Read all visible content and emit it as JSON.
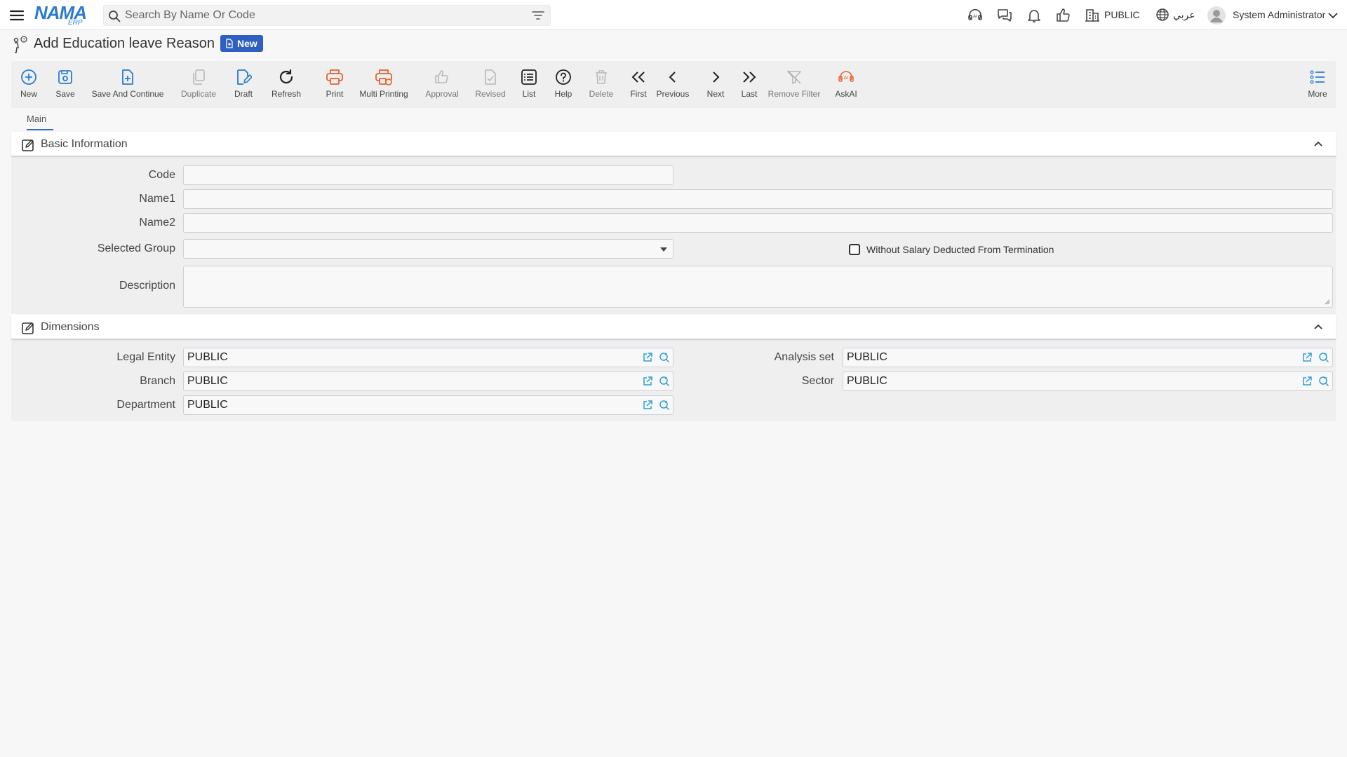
{
  "app": {
    "logo_text": "NAMA",
    "logo_sub": "ERP",
    "search_placeholder": "Search By Name Or Code",
    "company": "PUBLIC",
    "language": "عربي",
    "user": "System Administrator"
  },
  "page": {
    "title": "Add Education leave Reason",
    "badge": "New"
  },
  "toolbar": {
    "new": "New",
    "save": "Save",
    "save_continue": "Save And Continue",
    "duplicate": "Duplicate",
    "draft": "Draft",
    "refresh": "Refresh",
    "print": "Print",
    "multi_printing": "Multi Printing",
    "approval": "Approval",
    "revised": "Revised",
    "list": "List",
    "help": "Help",
    "delete": "Delete",
    "first": "First",
    "previous": "Previous",
    "next": "Next",
    "last": "Last",
    "remove_filter": "Remove Filter",
    "askai": "AskAI",
    "more": "More"
  },
  "tabs": {
    "main": "Main"
  },
  "basic": {
    "title": "Basic Information",
    "code_label": "Code",
    "code_value": "",
    "name1_label": "Name1",
    "name1_value": "",
    "name2_label": "Name2",
    "name2_value": "",
    "group_label": "Selected Group",
    "group_value": "",
    "without_salary_label": "Without Salary Deducted From Termination",
    "without_salary_checked": false,
    "description_label": "Description"
  },
  "dimensions": {
    "title": "Dimensions",
    "legal_entity_label": "Legal Entity",
    "legal_entity_value": "PUBLIC",
    "branch_label": "Branch",
    "branch_value": "PUBLIC",
    "department_label": "Department",
    "department_value": "PUBLIC",
    "analysis_set_label": "Analysis set",
    "analysis_set_value": "PUBLIC",
    "sector_label": "Sector",
    "sector_value": "PUBLIC"
  },
  "colors": {
    "accent": "#2b7bd0",
    "print_orange": "#e8612c",
    "badge_blue": "#2f5fbf",
    "link_blue": "#2a9fd6"
  }
}
